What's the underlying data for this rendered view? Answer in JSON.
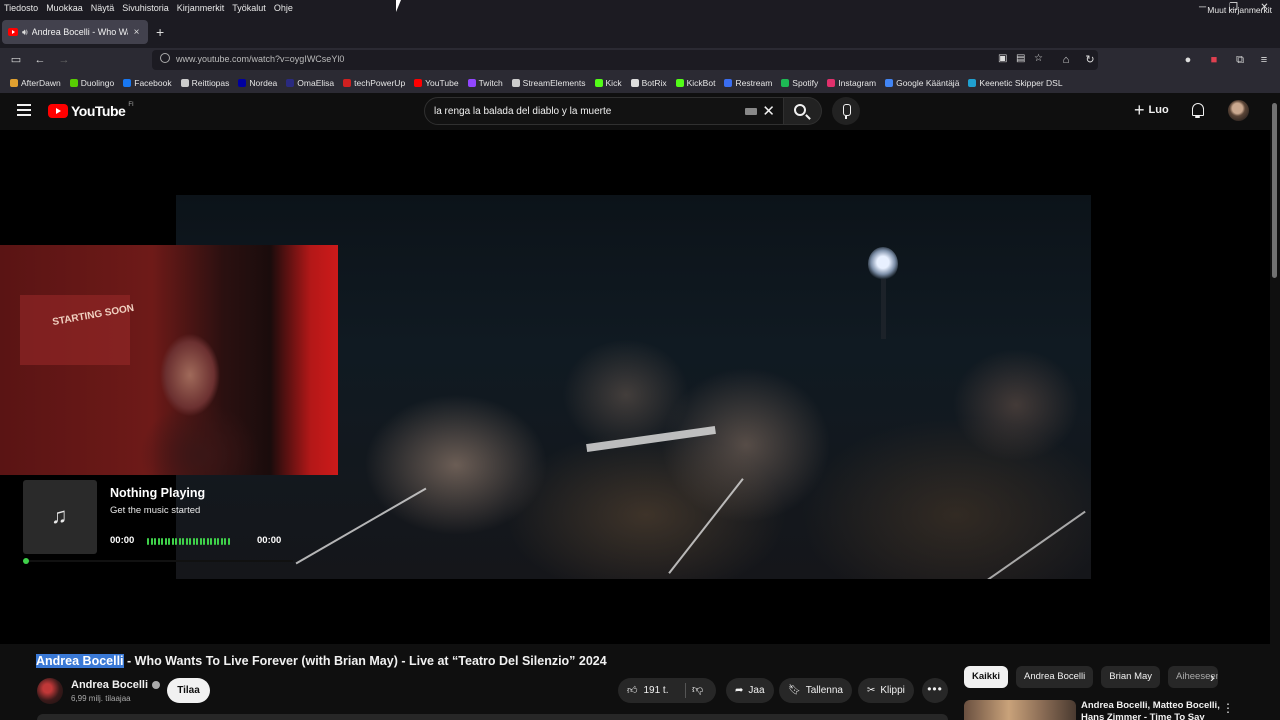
{
  "menu": [
    "Tiedosto",
    "Muokkaa",
    "Näytä",
    "Sivuhistoria",
    "Kirjanmerkit",
    "Työkalut",
    "Ohje"
  ],
  "tab": {
    "title": "Andrea Bocelli - Who Wants To Live Forever",
    "close": "×"
  },
  "newtab": "+",
  "url": "www.youtube.com/watch?v=oygIWCseYl0",
  "bookmarks": [
    {
      "label": "AfterDawn",
      "color": "#e0a030"
    },
    {
      "label": "Duolingo",
      "color": "#58cc02"
    },
    {
      "label": "Facebook",
      "color": "#1877f2"
    },
    {
      "label": "Reittiopas",
      "color": "#cccccc"
    },
    {
      "label": "Nordea",
      "color": "#0000a0"
    },
    {
      "label": "OmaElisa",
      "color": "#2a2a80"
    },
    {
      "label": "techPowerUp",
      "color": "#d02020"
    },
    {
      "label": "YouTube",
      "color": "#ff0000"
    },
    {
      "label": "Twitch",
      "color": "#9146ff"
    },
    {
      "label": "StreamElements",
      "color": "#cccccc"
    },
    {
      "label": "Kick",
      "color": "#53fc18"
    },
    {
      "label": "BotRix",
      "color": "#dddddd"
    },
    {
      "label": "KickBot",
      "color": "#53fc18"
    },
    {
      "label": "Restream",
      "color": "#3a6df0"
    },
    {
      "label": "Spotify",
      "color": "#1db954"
    },
    {
      "label": "Instagram",
      "color": "#e1306c"
    },
    {
      "label": "Google Kääntäjä",
      "color": "#4285f4"
    },
    {
      "label": "Keenetic Skipper DSL",
      "color": "#20a0d0"
    }
  ],
  "bookmarks_other": "Muut kirjanmerkit",
  "youtube": {
    "logo": "YouTube",
    "region": "FI",
    "search_query": "la renga la balada del diablo y la muerte",
    "create_label": "Luo"
  },
  "now_playing": {
    "title": "Nothing Playing",
    "subtitle": "Get the music started",
    "time_start": "00:00",
    "time_end": "00:00"
  },
  "overlay_sign": "STARTING SOON",
  "video": {
    "title_highlight": "Andrea Bocelli",
    "title_rest": " - Who Wants To Live Forever (with Brian May) - Live at “Teatro Del Silenzio” 2024",
    "channel": "Andrea Bocelli",
    "subscribers": "6,99 milj. tilaajaa",
    "subscribe_label": "Tilaa",
    "likes": "191 t.",
    "share_label": "Jaa",
    "save_label": "Tallenna",
    "clip_label": "Klippi",
    "more": "•••"
  },
  "chips": [
    "Kaikki",
    "Andrea Bocelli",
    "Brian May",
    "Aiheeseen liittyvät"
  ],
  "recommendation": {
    "title": "Andrea Bocelli, Matteo Bocelli, Hans Zimmer - Time To Say Goodbye"
  }
}
